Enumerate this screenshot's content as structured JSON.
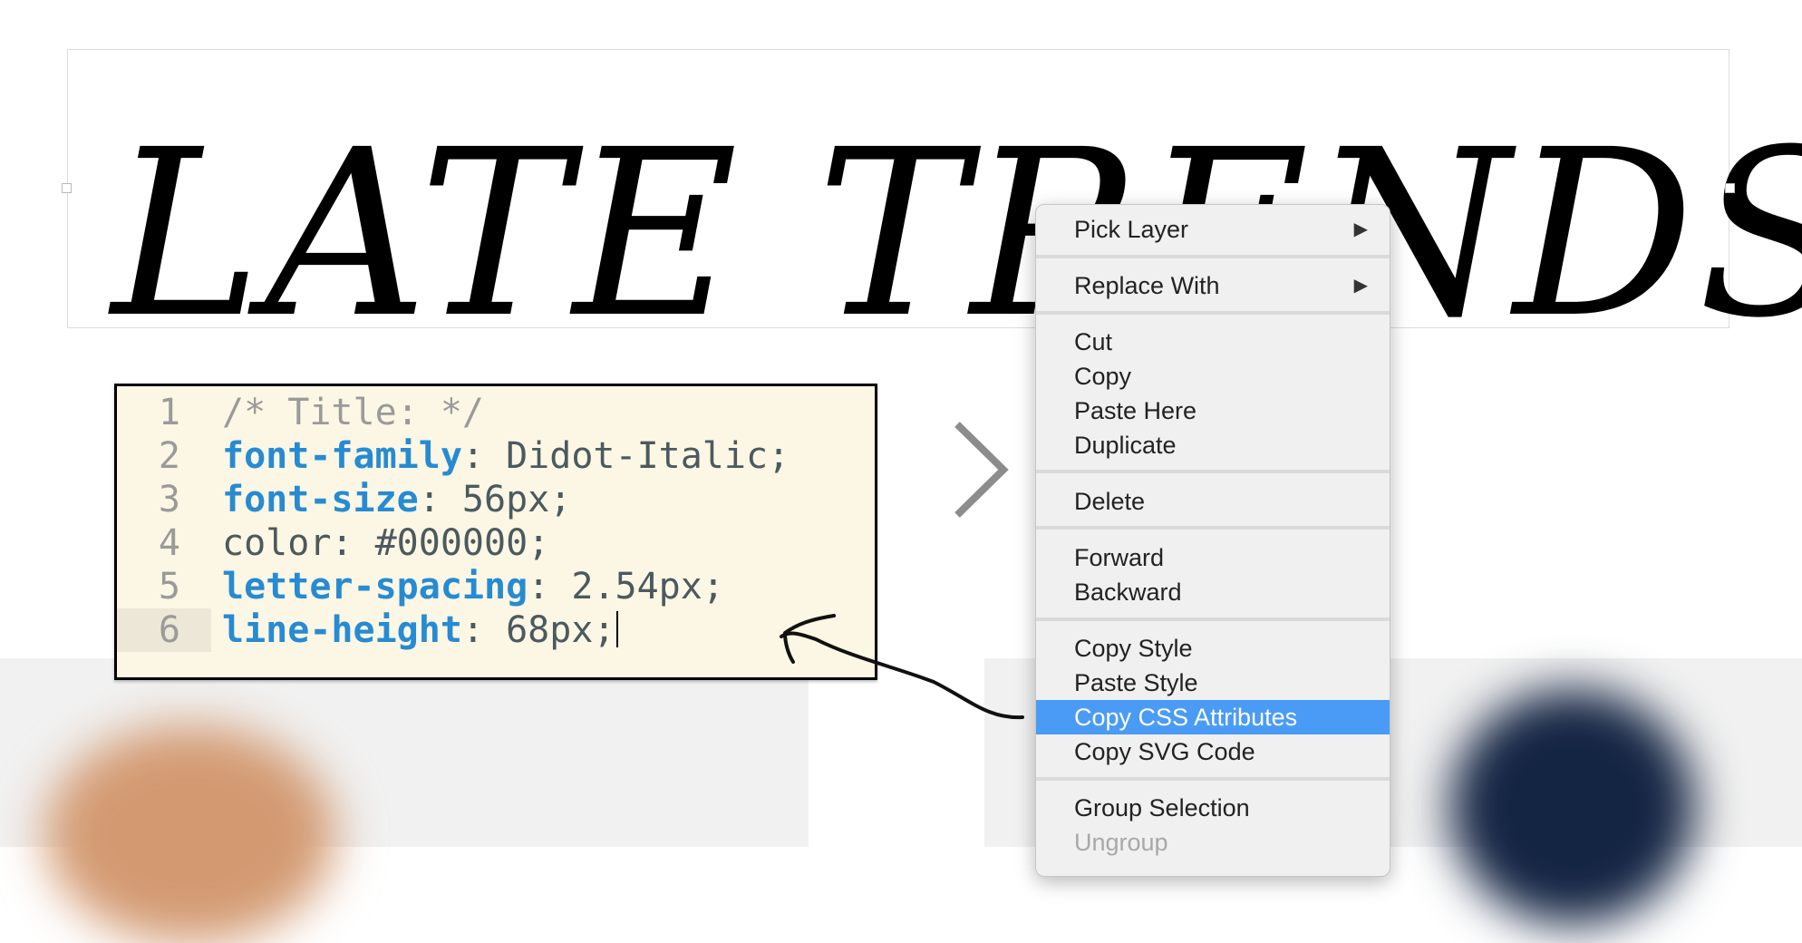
{
  "title": {
    "text": "LATE TRENDS"
  },
  "code_editor": {
    "lines": [
      {
        "num": "1",
        "comment": "/* Title: */",
        "prop": "",
        "value": ""
      },
      {
        "num": "2",
        "comment": "",
        "prop": "font-family",
        "value": ": Didot-Italic;"
      },
      {
        "num": "3",
        "comment": "",
        "prop": "font-size",
        "value": ": 56px;"
      },
      {
        "num": "4",
        "comment": "",
        "prop": "",
        "value": "color: #000000;"
      },
      {
        "num": "5",
        "comment": "",
        "prop": "letter-spacing",
        "value": ": 2.54px;"
      },
      {
        "num": "6",
        "comment": "",
        "prop": "line-height",
        "value": ": 68px;"
      }
    ]
  },
  "context_menu": {
    "items": {
      "pick_layer": "Pick Layer",
      "replace_with": "Replace With",
      "cut": "Cut",
      "copy": "Copy",
      "paste_here": "Paste Here",
      "duplicate": "Duplicate",
      "delete": "Delete",
      "forward": "Forward",
      "backward": "Backward",
      "copy_style": "Copy Style",
      "paste_style": "Paste Style",
      "copy_css_attributes": "Copy CSS Attributes",
      "copy_svg_code": "Copy SVG Code",
      "group_selection": "Group Selection",
      "ungroup": "Ungroup"
    },
    "submenu_arrow": "▶",
    "highlighted_item": "Copy CSS Attributes"
  },
  "colors": {
    "highlight": "#4a9bf5",
    "editor_bg": "#fcf6e4",
    "css_property": "#268bd2",
    "blob_orange": "#d39a72",
    "blob_navy": "#142443"
  },
  "icons": {
    "chevron": "chevron-right-icon",
    "hand_arrow": "hand-drawn-arrow-icon"
  }
}
